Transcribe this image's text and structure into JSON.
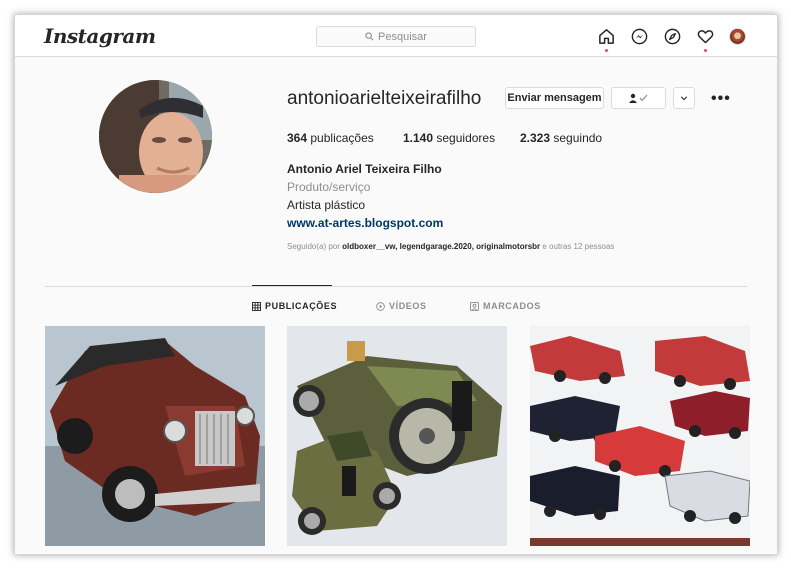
{
  "nav": {
    "logo": "Instagram",
    "search_placeholder": "Pesquisar"
  },
  "profile": {
    "username": "antonioarielteixeirafilho",
    "message_button": "Enviar mensagem",
    "more": "•••",
    "stats": {
      "posts_count": "364",
      "posts_label": "publicações",
      "followers_count": "1.140",
      "followers_label": "seguidores",
      "following_count": "2.323",
      "following_label": "seguindo"
    },
    "full_name": "Antonio Ariel Teixeira Filho",
    "category": "Produto/serviço",
    "bio": "Artista plástico",
    "website": "www.at-artes.blogspot.com",
    "followed_by_prefix": "Seguido(a) por",
    "followed_by_names": "oldboxer__vw, legendgarage.2020, originalmotorsbr",
    "followed_by_suffix": "e outras 12 pessoas"
  },
  "tabs": [
    {
      "label": "PUBLICAÇÕES",
      "active": true
    },
    {
      "label": "VÍDEOS",
      "active": false
    },
    {
      "label": "MARCADOS",
      "active": false
    }
  ],
  "posts": [
    {
      "subject": "red vintage roadster painting"
    },
    {
      "subject": "green vintage racing cars painting"
    },
    {
      "subject": "classic convertibles painting"
    }
  ],
  "colors": {
    "link": "#00376b",
    "secondary_text": "#8e8e8e",
    "notification": "#ed4956",
    "border": "#dbdbdb"
  }
}
